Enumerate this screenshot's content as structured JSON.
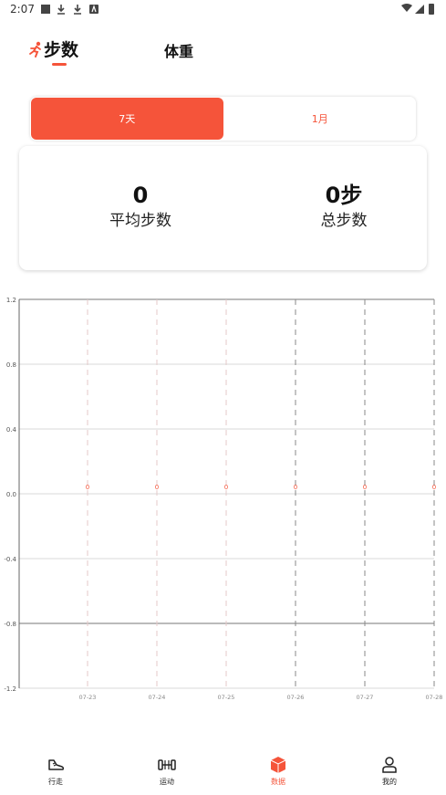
{
  "status_bar": {
    "time": "2:07"
  },
  "top_tabs": {
    "steps_label": "步数",
    "weight_label": "体重"
  },
  "range_toggle": {
    "options": [
      {
        "label": "7天",
        "selected": true
      },
      {
        "label": "1月",
        "selected": false
      }
    ]
  },
  "stats": {
    "average": {
      "value": "0",
      "label": "平均步数"
    },
    "total": {
      "value": "0步",
      "label": "总步数"
    }
  },
  "chart_data": {
    "type": "line",
    "categories": [
      "07-23",
      "07-24",
      "07-25",
      "07-26",
      "07-27",
      "07-28"
    ],
    "series": [
      {
        "values": [
          0,
          0,
          0,
          0,
          0,
          0
        ],
        "labels": [
          "0",
          "0",
          "0",
          "0",
          "0",
          "0"
        ]
      }
    ],
    "y_ticks": [
      "1.2",
      "0.8",
      "0.4",
      "0.0",
      "-0.4",
      "-0.8",
      "-1.2"
    ],
    "y_tick_values": [
      1.2,
      0.8,
      0.4,
      0.0,
      -0.4,
      -0.8,
      -1.2
    ],
    "ylim": [
      -1.2,
      1.2
    ],
    "grid": true,
    "colors": {
      "point": "#f5543a",
      "grid": "#cccccc",
      "axis": "#666666"
    }
  },
  "bottom_nav": {
    "items": [
      {
        "label": "行走",
        "icon": "shoe-icon",
        "active": false
      },
      {
        "label": "运动",
        "icon": "dumbbell-icon",
        "active": false
      },
      {
        "label": "数据",
        "icon": "cube-icon",
        "active": true
      },
      {
        "label": "我的",
        "icon": "person-icon",
        "active": false
      }
    ]
  },
  "colors": {
    "accent": "#f5543a",
    "text": "#111111",
    "background": "#ffffff"
  }
}
